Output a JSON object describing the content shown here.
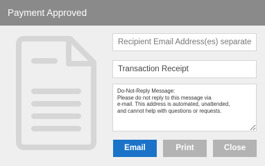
{
  "dialog": {
    "title": "Payment Approved"
  },
  "form": {
    "recipient_placeholder": "Recipient Email Address(es) separate w commas",
    "subject_value": "Transaction Receipt",
    "message_value": "Do-Not-Reply Message:\nPlease do not reply to this message via\ne-mail. This address is automated, unattended,\nand cannot help with questions or requests."
  },
  "buttons": {
    "email_label": "Email",
    "print_label": "Print",
    "close_label": "Close"
  },
  "colors": {
    "titlebar": "#8a8a8a",
    "primary_button": "#1a73c8",
    "secondary_button": "#b3b3b3",
    "icon": "#d6d6d6"
  },
  "icons": {
    "document": "document-icon"
  }
}
